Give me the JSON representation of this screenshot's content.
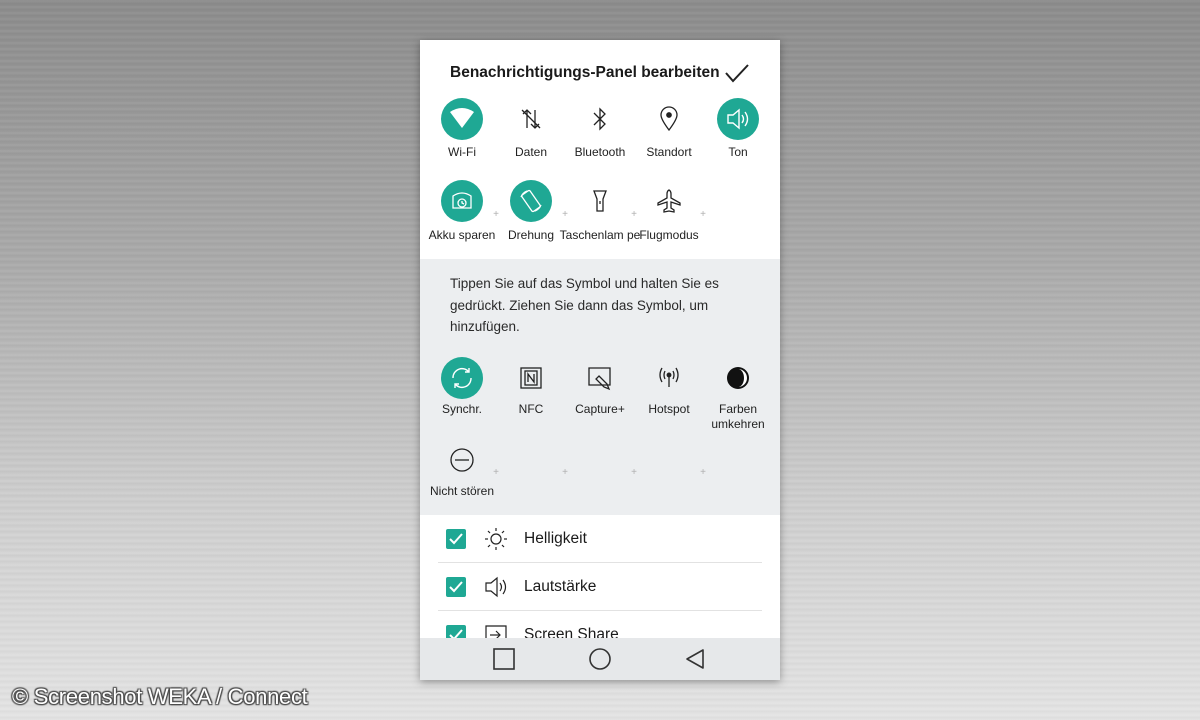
{
  "header": {
    "title": "Benachrichtigungs-Panel bearbeiten"
  },
  "active_tiles": [
    {
      "label": "Wi-Fi",
      "icon": "wifi-icon",
      "enabled": true
    },
    {
      "label": "Daten",
      "icon": "mobile-data-icon",
      "enabled": false
    },
    {
      "label": "Bluetooth",
      "icon": "bluetooth-icon",
      "enabled": false
    },
    {
      "label": "Standort",
      "icon": "location-pin-icon",
      "enabled": false
    },
    {
      "label": "Ton",
      "icon": "speaker-icon",
      "enabled": true
    },
    {
      "label": "Akku sparen",
      "icon": "battery-saver-icon",
      "enabled": true
    },
    {
      "label": "Drehung",
      "icon": "rotation-icon",
      "enabled": true
    },
    {
      "label": "Taschenlam pe",
      "icon": "flashlight-icon",
      "enabled": false
    },
    {
      "label": "Flugmodus",
      "icon": "airplane-icon",
      "enabled": false
    }
  ],
  "hint": "Tippen Sie auf das Symbol und halten Sie es gedrückt. Ziehen Sie dann das Symbol, um hinzufügen.",
  "available_tiles": [
    {
      "label": "Synchr.",
      "icon": "sync-icon",
      "enabled": true
    },
    {
      "label": "NFC",
      "icon": "nfc-icon",
      "enabled": false
    },
    {
      "label": "Capture+",
      "icon": "capture-plus-icon",
      "enabled": false
    },
    {
      "label": "Hotspot",
      "icon": "hotspot-icon",
      "enabled": false
    },
    {
      "label": "Farben umkehren",
      "icon": "invert-colors-icon",
      "enabled": false
    },
    {
      "label": "Nicht stören",
      "icon": "do-not-disturb-icon",
      "enabled": false
    }
  ],
  "sliders": [
    {
      "label": "Helligkeit",
      "icon": "brightness-icon",
      "checked": true
    },
    {
      "label": "Lautstärke",
      "icon": "volume-icon",
      "checked": true
    },
    {
      "label": "Screen Share",
      "icon": "screen-share-icon",
      "checked": true
    }
  ],
  "navbar": {
    "recent": "recent-apps-icon",
    "home": "home-icon",
    "back": "back-icon"
  },
  "watermark": "© Screenshot WEKA / Connect",
  "colors": {
    "accent": "#1fa894",
    "inactive_bg": "#eceef0",
    "navbar_bg": "#e6e8ea"
  }
}
